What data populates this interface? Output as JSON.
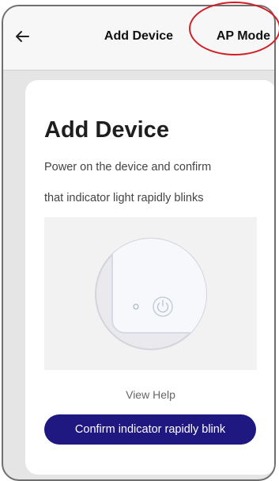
{
  "header": {
    "title": "Add Device",
    "ap_mode_label": "AP Mode",
    "back_icon": "arrow-left-icon"
  },
  "card": {
    "title": "Add Device",
    "description_line1": "Power on the device and confirm",
    "description_line2": "that indicator light rapidly blinks",
    "view_help_label": "View Help",
    "confirm_button_label": "Confirm indicator rapidly blink"
  },
  "colors": {
    "accent": "#1f1880",
    "annotation_circle": "#d21f26",
    "background": "#e5e5e5"
  }
}
